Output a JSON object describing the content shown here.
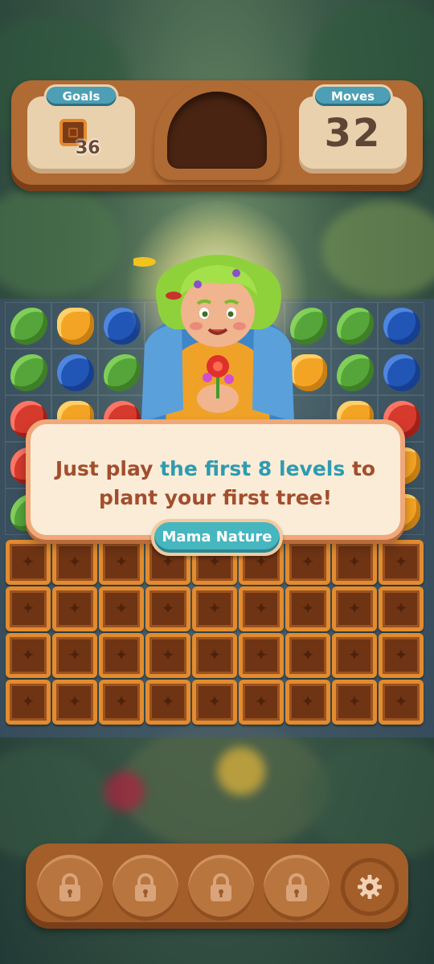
{
  "hud": {
    "goals_label": "Goals",
    "goal_count": "36",
    "goal_icon": "wooden-crate-icon",
    "moves_label": "Moves",
    "moves_count": "32"
  },
  "dialog": {
    "text_before": "Just play ",
    "text_highlight": "the first 8 levels",
    "text_after": " to plant your first tree!",
    "speaker": "Mama Nature",
    "highlight_color": "#2f9bb0",
    "text_color": "#a24e2c"
  },
  "board": {
    "columns": 9,
    "piece_types": [
      "leaf",
      "acorn",
      "berry",
      "rose"
    ],
    "visible_rows": [
      [
        "leaf",
        "acorn",
        "berry",
        "",
        "",
        "",
        "leaf",
        "leaf",
        "berry"
      ],
      [
        "leaf",
        "berry",
        "leaf",
        "",
        "",
        "",
        "acorn",
        "leaf",
        "berry"
      ],
      [
        "rose",
        "acorn",
        "rose",
        "",
        "",
        "",
        "",
        "acorn",
        "rose"
      ],
      [
        "rose",
        "",
        "",
        "",
        "",
        "",
        "",
        "",
        "acorn"
      ],
      [
        "leaf",
        "",
        "",
        "",
        "",
        "",
        "",
        "",
        "acorn"
      ]
    ],
    "crate_rows": 4
  },
  "boosters": [
    {
      "icon": "lock-icon",
      "locked": true
    },
    {
      "icon": "lock-icon",
      "locked": true
    },
    {
      "icon": "lock-icon",
      "locked": true
    },
    {
      "icon": "lock-icon",
      "locked": true
    }
  ],
  "settings_icon": "gear-icon"
}
